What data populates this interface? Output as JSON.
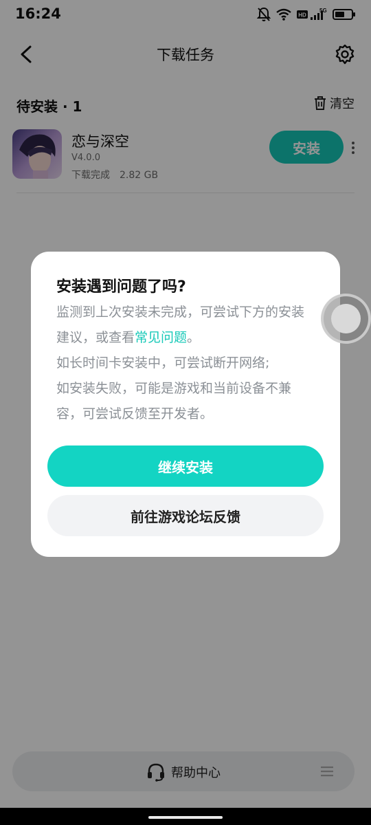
{
  "status_bar": {
    "time": "16:24",
    "network": "HD",
    "network_type": "5G"
  },
  "header": {
    "title": "下载任务"
  },
  "section": {
    "title": "待安装 · 1",
    "clear_label": "清空"
  },
  "app": {
    "name": "恋与深空",
    "version": "V4.0.0",
    "status": "下载完成",
    "size": "2.82 GB",
    "install_label": "安装"
  },
  "bottom_bar": {
    "help_label": "帮助中心"
  },
  "dialog": {
    "title": "安装遇到问题了吗?",
    "line1_prefix": "监测到上次安装未完成，可尝试下方的安装建议，或查看",
    "link_text": "常见问题",
    "line1_suffix": "。",
    "line2": "如长时间卡安装中，可尝试断开网络;",
    "line3": "如安装失败，可能是游戏和当前设备不兼容，可尝试反馈至开发者。",
    "primary_button": "继续安装",
    "secondary_button": "前往游戏论坛反馈"
  },
  "colors": {
    "accent": "#13d4c3",
    "link": "#18c9b8",
    "install_button": "#16c7b7"
  }
}
